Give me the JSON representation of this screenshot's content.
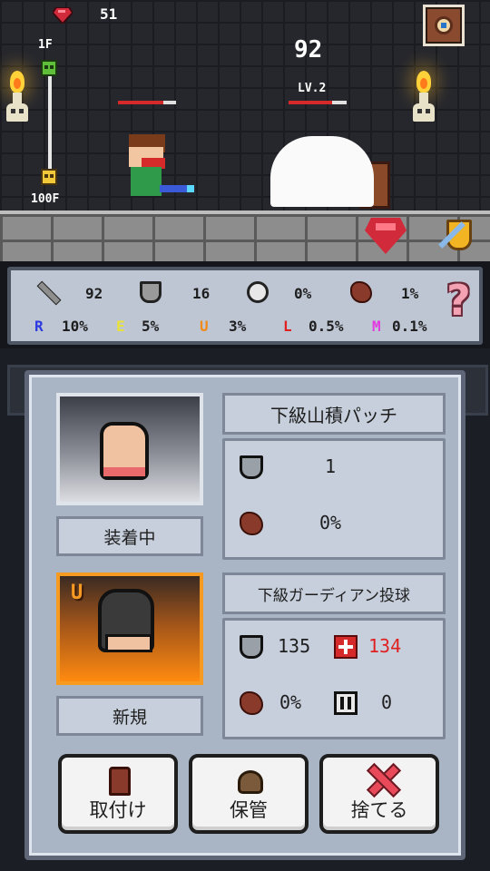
{
  "hud": {
    "gem_count": "51",
    "floor_top": "1F",
    "floor_bottom": "100F",
    "monster_hp": "92",
    "monster_level": "LV.2"
  },
  "stats": {
    "attack": "92",
    "defense": "16",
    "speed": "0%",
    "meat": "1%",
    "rarity": [
      {
        "letter": "R",
        "value": "10%",
        "color": "#2d3ae0"
      },
      {
        "letter": "E",
        "value": "5%",
        "color": "#e8e23a"
      },
      {
        "letter": "U",
        "value": "3%",
        "color": "#f08a1a"
      },
      {
        "letter": "L",
        "value": "0.5%",
        "color": "#e02020"
      },
      {
        "letter": "M",
        "value": "0.1%",
        "color": "#e23ae0"
      }
    ],
    "help_symbol": "?"
  },
  "dialog": {
    "current": {
      "status_label": "装着中",
      "name": "下級山積パッチ",
      "defense": "1",
      "meat": "0%"
    },
    "new_item": {
      "rank": "U",
      "status_label": "新規",
      "name": "下級ガーディアン投球",
      "defense": "135",
      "hp": "134",
      "meat": "0%",
      "pause": "0"
    },
    "actions": {
      "equip": "取付け",
      "store": "保管",
      "discard": "捨てる"
    }
  },
  "colors": {
    "accent_red": "#e02020",
    "new_item_orange": "#f79a22"
  }
}
